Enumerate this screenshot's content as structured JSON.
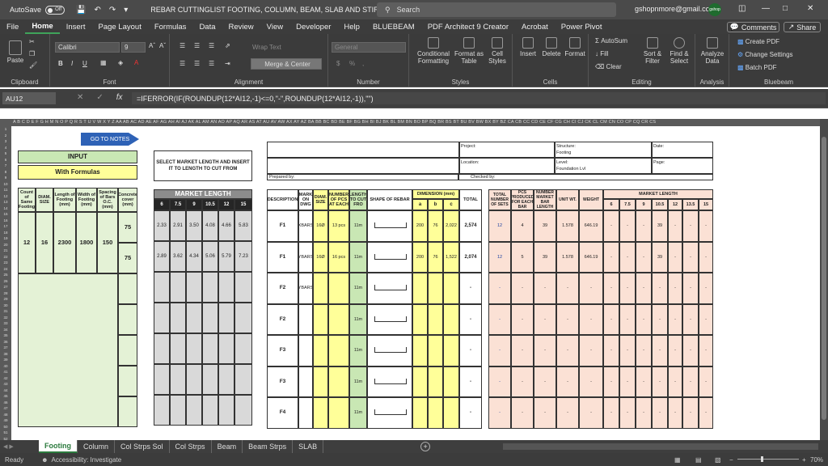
{
  "titlebar": {
    "autosave_label": "AutoSave",
    "autosave_state": "Off",
    "doc_title": "REBAR CUTTINGLIST FOOTING, COLUMN, BEAM, SLAB AND STIRRUPS",
    "search_placeholder": "Search",
    "user_email": "gshopnmore@gmail.com",
    "avatar_text": "gshop"
  },
  "menu": [
    "File",
    "Home",
    "Insert",
    "Page Layout",
    "Formulas",
    "Data",
    "Review",
    "View",
    "Developer",
    "Help",
    "BLUEBEAM",
    "PDF Architect 9 Creator",
    "Acrobat",
    "Power Pivot"
  ],
  "menu_active": "Home",
  "comments_label": "Comments",
  "share_label": "Share",
  "ribbon": {
    "clipboard": "Clipboard",
    "paste": "Paste",
    "font": "Font",
    "font_name": "Calibri",
    "font_size": "9",
    "alignment": "Alignment",
    "wrap_text": "Wrap Text",
    "merge_center": "Merge & Center",
    "number": "Number",
    "number_format": "General",
    "styles": "Styles",
    "cond_format": "Conditional Formatting",
    "format_table": "Format as Table",
    "cell_styles": "Cell Styles",
    "cells": "Cells",
    "insert": "Insert",
    "delete": "Delete",
    "format": "Format",
    "editing": "Editing",
    "autosum": "AutoSum",
    "fill": "Fill",
    "clear": "Clear",
    "sort_filter": "Sort & Filter",
    "find_select": "Find & Select",
    "analysis": "Analysis",
    "analyze_data": "Analyze Data",
    "bluebeam": "Bluebeam",
    "create_pdf": "Create PDF",
    "change_settings": "Change Settings",
    "batch_pdf": "Batch PDF"
  },
  "formula_bar": {
    "name_box": "AU12",
    "formula": "=IFERROR(IF(ROUNDUP(12*AI12,-1)<=0,\"-\",ROUNDUP(12*AI12,-1)),\"\")"
  },
  "columns_row": "A  B  C  D  E  F  G  H  M N O P Q R S T U V W X Y Z AA AB AC AD AE AF AG AH AI AJ AK AL AM AN AO AP AQ AR AS AT AU AV AW AX AY AZ BA BB BC BD BE BF BG BH BI BJ BK BL BM BN BO BP BQ BR BS BT BU BV BW BX BY BZ CA CB CC CD CE CF CG CH CI CJ CK CL CM CN CO CP CQ CR CS",
  "sheet": {
    "goto_notes": "GO TO NOTES",
    "input_title": "INPUT",
    "input_subtitle": "With Formulas",
    "input_headers": [
      "Count of Same Footing",
      "DIAM. SIZE",
      "Length of Footing (mm)",
      "Width of Footing (mm)",
      "Spacing of Bars O.C. (mm)",
      "Concrete cover (mm)"
    ],
    "input_values": [
      "12",
      "16",
      "2300",
      "1800",
      "150"
    ],
    "cover_values": [
      "75",
      "75"
    ],
    "select_market": "SELECT MARKET LENGTH AND INSERT IT TO LENGTH TO CUT FROM",
    "market_length_title": "MARKET LENGTH",
    "market_lengths": [
      "6",
      "7.5",
      "9",
      "10.5",
      "12",
      "15"
    ],
    "market_row1": [
      "2.33",
      "2.91",
      "3.50",
      "4.08",
      "4.66",
      "5.83"
    ],
    "market_row2": [
      "2.89",
      "3.62",
      "4.34",
      "5.06",
      "5.79",
      "7.23"
    ],
    "project_label": "Project:",
    "structure_label": "Structure:",
    "structure_value": "Footing",
    "date_label": "Date:",
    "location_label": "Location:",
    "level_label": "Level:",
    "level_value": "Foundation Lvl",
    "page_label": "Page:",
    "prepared_by": "Prepared by:",
    "checked_by": "Checked by:",
    "main_headers": [
      "DESCRIPTION",
      "MARK ON DWG",
      "DIAM. SIZE",
      "NUMBER OF PCS AT EACH",
      "LENGTH TO CUT FRO",
      "SHAPE OF REBAR",
      "DIMENSION (mm)",
      "TOTAL"
    ],
    "dim_sub": [
      "a",
      "b",
      "c"
    ],
    "right_headers": [
      "TOTAL NUMBER OF SETS",
      "PCS PRODUCED FOR EACH BAR",
      "NUMBER MARKET BAR LENGTH",
      "UNIT WT.",
      "WEIGHT"
    ],
    "right_market_title": "MARKET LENGTH",
    "right_market_lengths": [
      "6",
      "7.5",
      "9",
      "10.5",
      "12",
      "13.5",
      "15"
    ],
    "rows": [
      {
        "desc": "F1",
        "mark": "XBARS",
        "diam": "16Ø",
        "pcs": "13 pcs",
        "len": "11m",
        "a": "200",
        "b": "76",
        "c": "2,022",
        "total": "2,574",
        "sets": "12",
        "prod": "4",
        "nmb": "39",
        "unit": "1.578",
        "wt": "646.19",
        "m105": "39"
      },
      {
        "desc": "F1",
        "mark": "YBARS",
        "diam": "16Ø",
        "pcs": "16 pcs",
        "len": "11m",
        "a": "200",
        "b": "76",
        "c": "1,522",
        "total": "2,074",
        "sets": "12",
        "prod": "5",
        "nmb": "39",
        "unit": "1.578",
        "wt": "646.19",
        "m105": "39"
      },
      {
        "desc": "F2",
        "mark": "YBARS",
        "diam": "",
        "pcs": "",
        "len": "11m",
        "a": "",
        "b": "",
        "c": "",
        "total": "-",
        "sets": "-",
        "prod": "-",
        "nmb": "-",
        "unit": "-",
        "wt": "-",
        "m105": "-"
      },
      {
        "desc": "F2",
        "mark": "",
        "diam": "",
        "pcs": "",
        "len": "11m",
        "a": "",
        "b": "",
        "c": "",
        "total": "-",
        "sets": "-",
        "prod": "-",
        "nmb": "-",
        "unit": "-",
        "wt": "-",
        "m105": "-"
      },
      {
        "desc": "F3",
        "mark": "",
        "diam": "",
        "pcs": "",
        "len": "11m",
        "a": "",
        "b": "",
        "c": "",
        "total": "-",
        "sets": "-",
        "prod": "-",
        "nmb": "-",
        "unit": "-",
        "wt": "-",
        "m105": "-"
      },
      {
        "desc": "F3",
        "mark": "",
        "diam": "",
        "pcs": "",
        "len": "11m",
        "a": "",
        "b": "",
        "c": "",
        "total": "-",
        "sets": "-",
        "prod": "-",
        "nmb": "-",
        "unit": "-",
        "wt": "-",
        "m105": "-"
      },
      {
        "desc": "F4",
        "mark": "",
        "diam": "",
        "pcs": "",
        "len": "11m",
        "a": "",
        "b": "",
        "c": "",
        "total": "-",
        "sets": "-",
        "prod": "-",
        "nmb": "-",
        "unit": "-",
        "wt": "-",
        "m105": "-"
      }
    ],
    "shape_labels": [
      "a",
      "b",
      "c"
    ],
    "dash": "-"
  },
  "tabs": [
    "Footing",
    "Column",
    "Col Strps Sol",
    "Col Strps",
    "Beam",
    "Beam Strps",
    "SLAB"
  ],
  "tab_active": "Footing",
  "status": {
    "ready": "Ready",
    "accessibility": "Accessibility: Investigate",
    "zoom": "70%"
  }
}
